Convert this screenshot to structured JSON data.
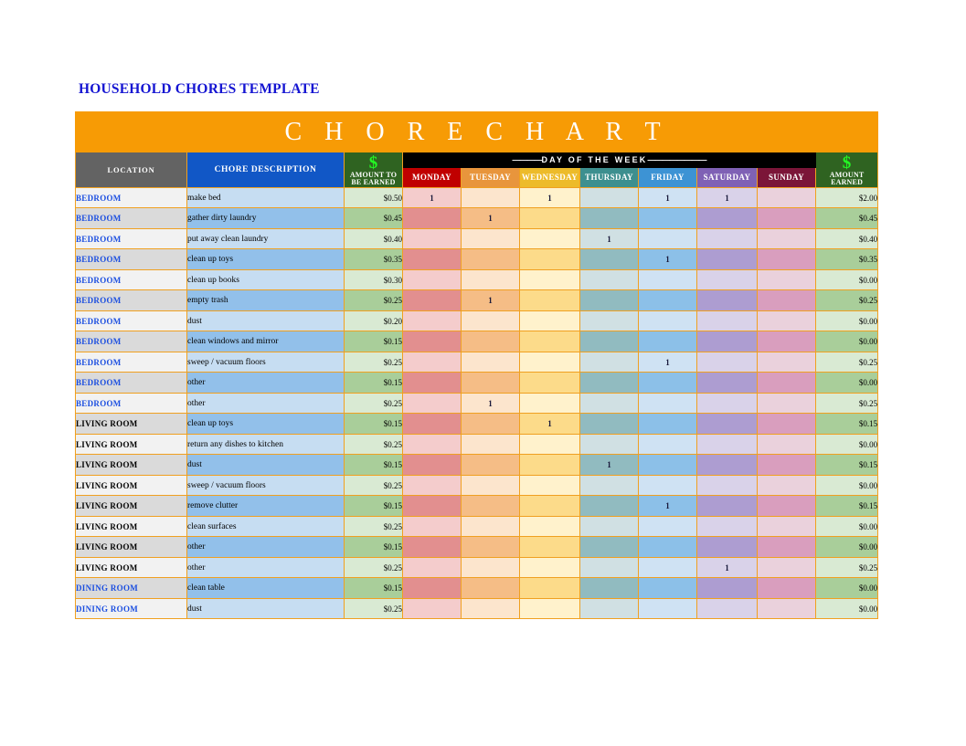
{
  "document": {
    "title": "HOUSEHOLD CHORES TEMPLATE"
  },
  "banner": {
    "title": "C H O R E   C H A R T"
  },
  "colors": {
    "banner_bg": "#f79b05",
    "location_hdr_bg": "#636363",
    "desc_hdr_bg": "#1157c6",
    "money_hdr_bg": "#2f6321",
    "dollar_glyph": "#23f723",
    "day_band_bg": "#000000",
    "grid_line": "#f0a020",
    "title_text": "#1414d2",
    "monday": "#c00000",
    "tuesday": "#e8953c",
    "wednesday": "#edbb2a",
    "thursday": "#3d8f8f",
    "friday": "#3d93d4",
    "saturday": "#7f61b5",
    "sunday": "#7b1538"
  },
  "headers": {
    "location": "LOCATION",
    "description": "CHORE DESCRIPTION",
    "dollar_glyph": "$",
    "amount_to_be_earned_line1": "AMOUNT TO",
    "amount_to_be_earned_line2": "BE EARNED",
    "day_band_rule_left": "————",
    "day_band_label": "DAY OF THE WEEK",
    "day_band_rule_right": "————————",
    "amount_earned_line1": "AMOUNT",
    "amount_earned_line2": "EARNED",
    "days": [
      "MONDAY",
      "TUESDAY",
      "WEDNESDAY",
      "THURSDAY",
      "FRIDAY",
      "SATURDAY",
      "SUNDAY"
    ]
  },
  "mark": "1",
  "rows": [
    {
      "location": "BEDROOM",
      "loc_style": "blue",
      "description": "make bed",
      "amount": "$0.50",
      "days": [
        "1",
        "",
        "1",
        "",
        "1",
        "1",
        ""
      ],
      "earned": "$2.00"
    },
    {
      "location": "BEDROOM",
      "loc_style": "blue",
      "description": "gather dirty laundry",
      "amount": "$0.45",
      "days": [
        "",
        "1",
        "",
        "",
        "",
        "",
        ""
      ],
      "earned": "$0.45"
    },
    {
      "location": "BEDROOM",
      "loc_style": "blue",
      "description": "put away clean laundry",
      "amount": "$0.40",
      "days": [
        "",
        "",
        "",
        "1",
        "",
        "",
        ""
      ],
      "earned": "$0.40"
    },
    {
      "location": "BEDROOM",
      "loc_style": "blue",
      "description": "clean up toys",
      "amount": "$0.35",
      "days": [
        "",
        "",
        "",
        "",
        "1",
        "",
        ""
      ],
      "earned": "$0.35"
    },
    {
      "location": "BEDROOM",
      "loc_style": "blue",
      "description": "clean up books",
      "amount": "$0.30",
      "days": [
        "",
        "",
        "",
        "",
        "",
        "",
        ""
      ],
      "earned": "$0.00"
    },
    {
      "location": "BEDROOM",
      "loc_style": "blue",
      "description": "empty trash",
      "amount": "$0.25",
      "days": [
        "",
        "1",
        "",
        "",
        "",
        "",
        ""
      ],
      "earned": "$0.25"
    },
    {
      "location": "BEDROOM",
      "loc_style": "blue",
      "description": "dust",
      "amount": "$0.20",
      "days": [
        "",
        "",
        "",
        "",
        "",
        "",
        ""
      ],
      "earned": "$0.00"
    },
    {
      "location": "BEDROOM",
      "loc_style": "blue",
      "description": "clean windows and mirror",
      "amount": "$0.15",
      "days": [
        "",
        "",
        "",
        "",
        "",
        "",
        ""
      ],
      "earned": "$0.00"
    },
    {
      "location": "BEDROOM",
      "loc_style": "blue",
      "description": "sweep / vacuum floors",
      "amount": "$0.25",
      "days": [
        "",
        "",
        "",
        "",
        "1",
        "",
        ""
      ],
      "earned": "$0.25"
    },
    {
      "location": "BEDROOM",
      "loc_style": "blue",
      "description": "other",
      "amount": "$0.15",
      "days": [
        "",
        "",
        "",
        "",
        "",
        "",
        ""
      ],
      "earned": "$0.00"
    },
    {
      "location": "BEDROOM",
      "loc_style": "blue",
      "description": "other",
      "amount": "$0.25",
      "days": [
        "",
        "1",
        "",
        "",
        "",
        "",
        ""
      ],
      "earned": "$0.25"
    },
    {
      "location": "LIVING ROOM",
      "loc_style": "black",
      "description": "clean up toys",
      "amount": "$0.15",
      "days": [
        "",
        "",
        "1",
        "",
        "",
        "",
        ""
      ],
      "earned": "$0.15"
    },
    {
      "location": "LIVING ROOM",
      "loc_style": "black",
      "description": "return any dishes to kitchen",
      "amount": "$0.25",
      "days": [
        "",
        "",
        "",
        "",
        "",
        "",
        ""
      ],
      "earned": "$0.00"
    },
    {
      "location": "LIVING ROOM",
      "loc_style": "black",
      "description": "dust",
      "amount": "$0.15",
      "days": [
        "",
        "",
        "",
        "1",
        "",
        "",
        ""
      ],
      "earned": "$0.15"
    },
    {
      "location": "LIVING ROOM",
      "loc_style": "black",
      "description": "sweep / vacuum floors",
      "amount": "$0.25",
      "days": [
        "",
        "",
        "",
        "",
        "",
        "",
        ""
      ],
      "earned": "$0.00"
    },
    {
      "location": "LIVING ROOM",
      "loc_style": "black",
      "description": "remove clutter",
      "amount": "$0.15",
      "days": [
        "",
        "",
        "",
        "",
        "1",
        "",
        ""
      ],
      "earned": "$0.15"
    },
    {
      "location": "LIVING ROOM",
      "loc_style": "black",
      "description": "clean surfaces",
      "amount": "$0.25",
      "days": [
        "",
        "",
        "",
        "",
        "",
        "",
        ""
      ],
      "earned": "$0.00"
    },
    {
      "location": "LIVING ROOM",
      "loc_style": "black",
      "description": "other",
      "amount": "$0.15",
      "days": [
        "",
        "",
        "",
        "",
        "",
        "",
        ""
      ],
      "earned": "$0.00"
    },
    {
      "location": "LIVING ROOM",
      "loc_style": "black",
      "description": "other",
      "amount": "$0.25",
      "days": [
        "",
        "",
        "",
        "",
        "",
        "1",
        ""
      ],
      "earned": "$0.25"
    },
    {
      "location": "DINING ROOM",
      "loc_style": "blue",
      "description": "clean table",
      "amount": "$0.15",
      "days": [
        "",
        "",
        "",
        "",
        "",
        "",
        ""
      ],
      "earned": "$0.00"
    },
    {
      "location": "DINING ROOM",
      "loc_style": "blue",
      "description": "dust",
      "amount": "$0.25",
      "days": [
        "",
        "",
        "",
        "",
        "",
        "",
        ""
      ],
      "earned": "$0.00"
    }
  ]
}
